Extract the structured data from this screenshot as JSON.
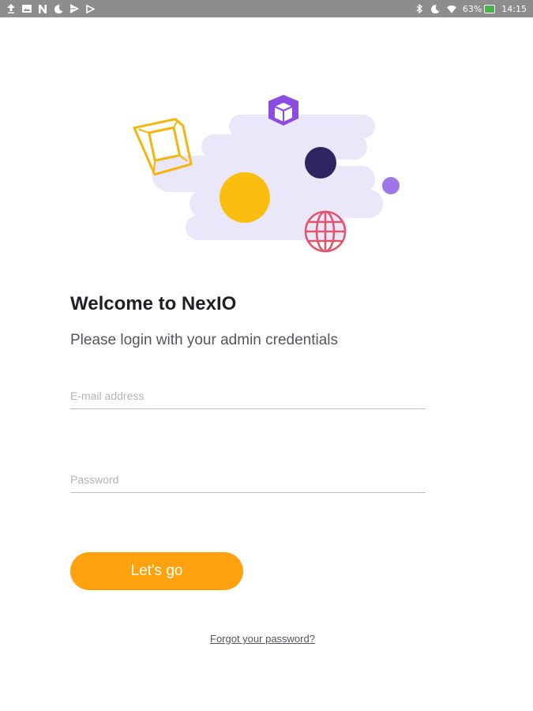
{
  "status_bar": {
    "battery_percent": "63%",
    "time": "14:15"
  },
  "login": {
    "title": "Welcome to NexIO",
    "subtitle": "Please login with your admin credentials",
    "email_placeholder": "E-mail address",
    "password_placeholder": "Password",
    "submit_label": "Let's go",
    "forgot_label": "Forgot your password?"
  },
  "colors": {
    "accent": "#ffa20d",
    "status_bar_bg": "#8d8d8f",
    "cloud": "#ebe7fb",
    "navy": "#2f2561",
    "purple": "#8a4de0",
    "yellow": "#fbbd10",
    "red": "#e0566b"
  },
  "icons": [
    "upload-icon",
    "image-icon",
    "notification-n-icon",
    "moon-icon",
    "play-store-icon",
    "media-icon",
    "bluetooth-icon",
    "moon-icon",
    "wifi-icon",
    "battery-icon"
  ]
}
